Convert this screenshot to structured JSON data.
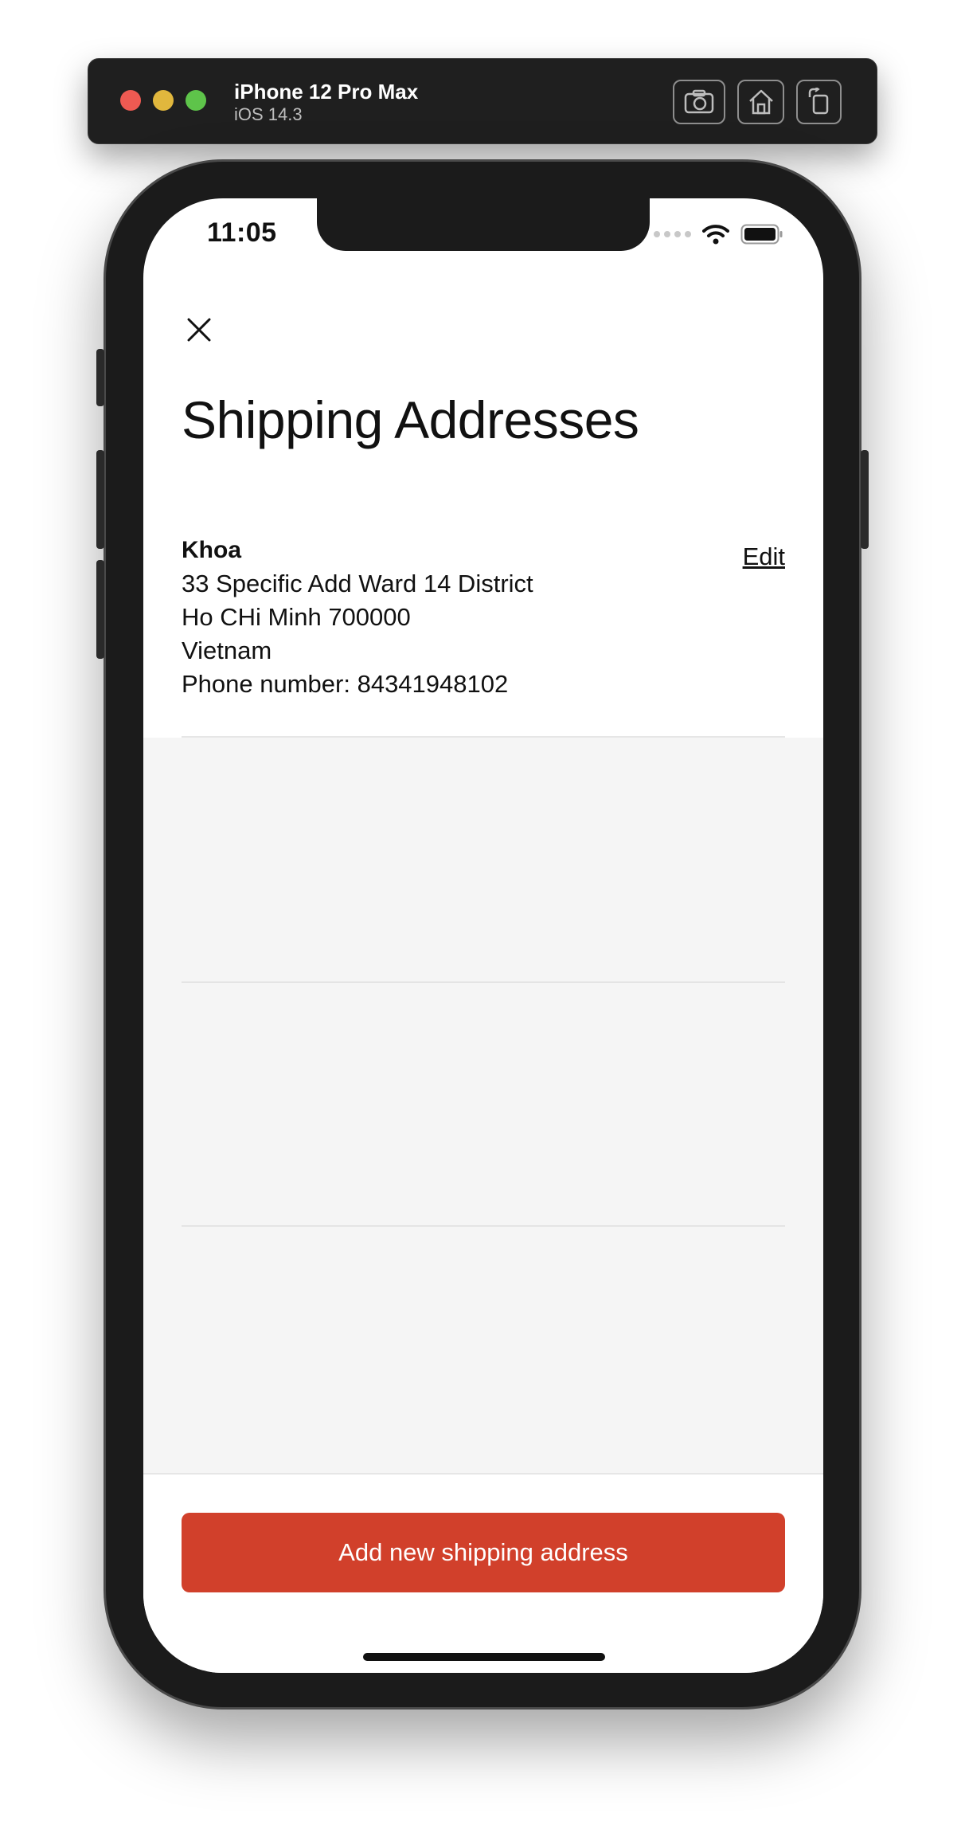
{
  "simulator": {
    "device_name": "iPhone 12 Pro Max",
    "os_version": "iOS 14.3"
  },
  "status_bar": {
    "time": "11:05"
  },
  "page": {
    "title": "Shipping Addresses"
  },
  "address": {
    "name": "Khoa",
    "street": "33 Specific Add Ward 14 District",
    "city_line": "Ho CHi Minh 700000",
    "country": "Vietnam",
    "phone": "Phone number: 84341948102",
    "edit_label": "Edit"
  },
  "actions": {
    "add_label": "Add new shipping address"
  },
  "colors": {
    "accent": "#d1402b",
    "background": "#ffffff",
    "empty_area": "#f5f5f5"
  }
}
